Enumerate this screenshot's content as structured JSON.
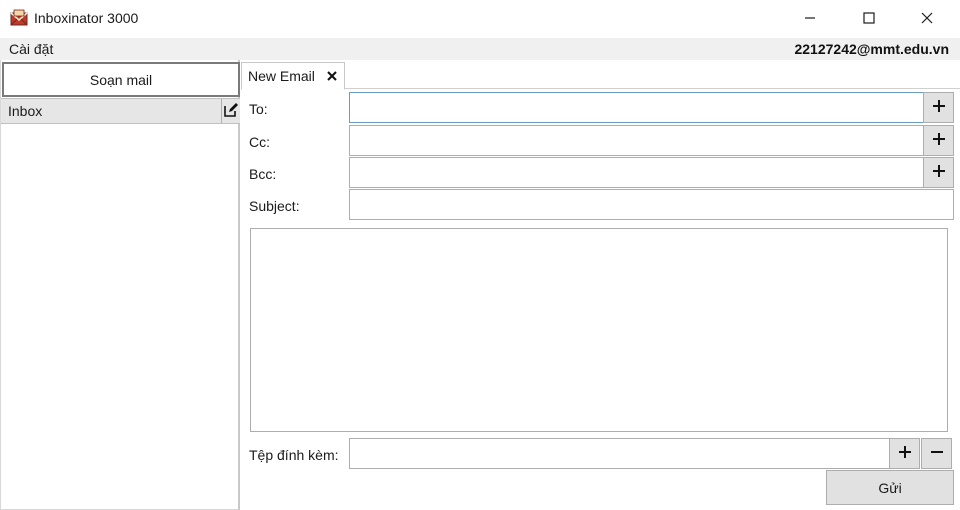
{
  "window": {
    "title": "Inboxinator 3000",
    "app_icon": "envelope-app-icon",
    "controls": [
      "minimize-icon",
      "maximize-icon",
      "close-icon"
    ]
  },
  "menubar": {
    "settings_label": "Cài đặt",
    "user_email": "22127242@mmt.edu.vn"
  },
  "sidebar": {
    "compose_label": "Soạn mail",
    "folders": [
      {
        "label": "Inbox",
        "edit_icon": "edit-icon"
      }
    ]
  },
  "tabs": [
    {
      "label": "New Email",
      "close_icon": "close-icon"
    }
  ],
  "compose": {
    "to_label": "To:",
    "to_value": "",
    "cc_label": "Cc:",
    "cc_value": "",
    "bcc_label": "Bcc:",
    "bcc_value": "",
    "subject_label": "Subject:",
    "subject_value": "",
    "body_value": "",
    "attachment_label": "Tệp đính kèm:",
    "attachment_value": "",
    "add_icon": "plus-icon",
    "remove_icon": "minus-icon",
    "send_label": "Gửi"
  }
}
